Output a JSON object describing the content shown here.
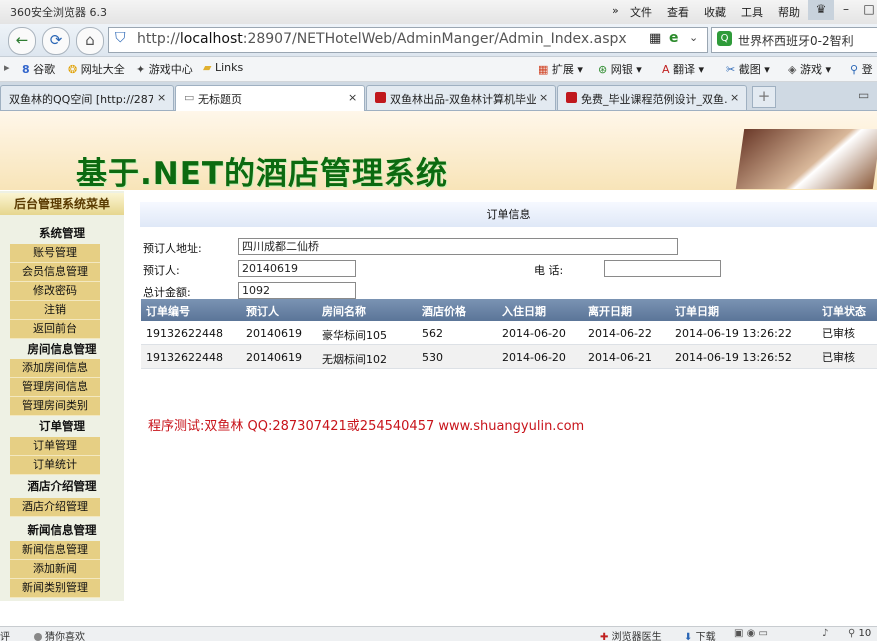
{
  "window": {
    "app_title": "360安全浏览器 6.3",
    "menu": [
      "»",
      "文件",
      "查看",
      "收藏",
      "工具",
      "帮助"
    ],
    "controls": [
      "–",
      "□",
      "×"
    ]
  },
  "navbar": {
    "url_prefix": "http://",
    "url_host": "localhost",
    "url_rest": ":28907/NETHotelWeb/AdminManger/Admin_Index.aspx",
    "search_text": "世界杯西班牙0-2智利"
  },
  "bookmarks": {
    "left": [
      "谷歌",
      "网址大全",
      "游戏中心",
      "Links"
    ],
    "right": [
      "扩展",
      "网银",
      "翻译",
      "截图",
      "游戏",
      "登"
    ]
  },
  "tabs": [
    {
      "label": "双鱼林的QQ空间 [http://287…",
      "active": false
    },
    {
      "label": "无标题页",
      "active": true
    },
    {
      "label": "双鱼林出品-双鱼林计算机毕业…",
      "active": false
    },
    {
      "label": "免费_毕业课程范例设计_双鱼…",
      "active": false
    }
  ],
  "banner": {
    "title": "基于.NET的酒店管理系统"
  },
  "sidebar": {
    "title": "后台管理系统菜单",
    "sections": [
      {
        "title": "系统管理",
        "items": [
          "账号管理",
          "会员信息管理",
          "修改密码",
          "注销",
          "返回前台"
        ]
      },
      {
        "title": "房间信息管理",
        "items": [
          "添加房间信息",
          "管理房间信息",
          "管理房间类别"
        ]
      },
      {
        "title": "订单管理",
        "items": [
          "订单管理",
          "订单统计"
        ]
      },
      {
        "title": "酒店介绍管理",
        "items": [
          "酒店介绍管理"
        ]
      },
      {
        "title": "新闻信息管理",
        "items": [
          "新闻信息管理",
          "添加新闻",
          "新闻类别管理"
        ]
      }
    ]
  },
  "order": {
    "panel_title": "订单信息",
    "address_label": "预订人地址:",
    "address_value": "四川成都二仙桥",
    "booker_label": "预订人:",
    "booker_value": "20140619",
    "phone_label": "电  话:",
    "phone_value": "",
    "total_label": "总计金额:",
    "total_value": "1092"
  },
  "table": {
    "headers": [
      "订单编号",
      "预订人",
      "房间名称",
      "酒店价格",
      "入住日期",
      "离开日期",
      "订单日期",
      "订单状态"
    ],
    "rows": [
      [
        "19132622448",
        "20140619",
        "豪华标间105",
        "562",
        "2014-06-20",
        "2014-06-22",
        "2014-06-19 13:26:22",
        "已审核"
      ],
      [
        "19132622448",
        "20140619",
        "无烟标间102",
        "530",
        "2014-06-20",
        "2014-06-21",
        "2014-06-19 13:26:52",
        "已审核"
      ]
    ]
  },
  "note": "程序测试:双鱼林 QQ:287307421或254540457 www.shuangyulin.com",
  "status": {
    "left": [
      "评",
      "猜你喜欢"
    ],
    "right": [
      "浏览器医生",
      "下载",
      "10"
    ]
  }
}
